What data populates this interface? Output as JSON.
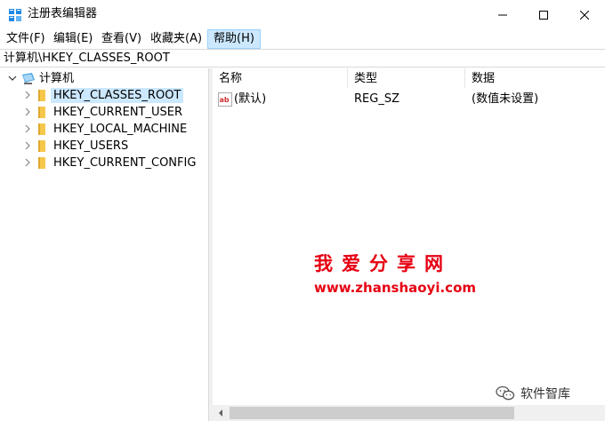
{
  "window": {
    "title": "注册表编辑器",
    "icon": "registry-editor-icon"
  },
  "menu": {
    "file": "文件(F)",
    "edit": "编辑(E)",
    "view": "查看(V)",
    "favorites": "收藏夹(A)",
    "help": "帮助(H)"
  },
  "address": {
    "path": "计算机\\HKEY_CLASSES_ROOT"
  },
  "tree": {
    "root": "计算机",
    "items": [
      {
        "label": "HKEY_CLASSES_ROOT"
      },
      {
        "label": "HKEY_CURRENT_USER"
      },
      {
        "label": "HKEY_LOCAL_MACHINE"
      },
      {
        "label": "HKEY_USERS"
      },
      {
        "label": "HKEY_CURRENT_CONFIG"
      }
    ],
    "selected": "HKEY_CLASSES_ROOT"
  },
  "list": {
    "columns": {
      "name": "名称",
      "type": "类型",
      "data": "数据"
    },
    "rows": [
      {
        "name": "(默认)",
        "type": "REG_SZ",
        "data": "(数值未设置)"
      }
    ]
  },
  "watermark": {
    "title": "我爱分享网",
    "url": "www.zhanshaoyi.com"
  },
  "badge": {
    "text": "软件智库"
  },
  "colors": {
    "selection": "#cce8ff",
    "folder": "#f5c84c",
    "watermark": "#e60012"
  }
}
